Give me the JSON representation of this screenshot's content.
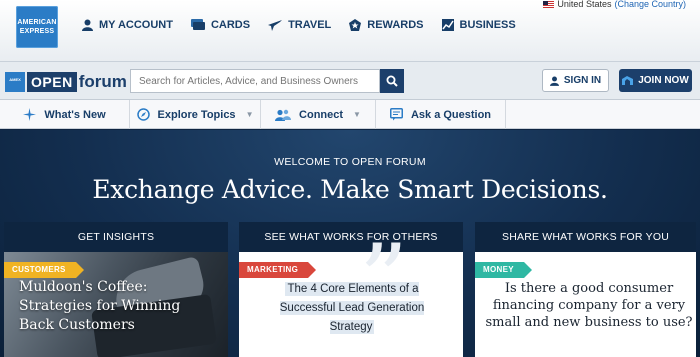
{
  "country": {
    "name": "United States",
    "change_link": "(Change Country)"
  },
  "brand": {
    "logo_top": "AMERICAN",
    "logo_bottom": "EXPRESS"
  },
  "topnav": [
    {
      "label": "MY ACCOUNT",
      "icon": "person-icon"
    },
    {
      "label": "CARDS",
      "icon": "cards-icon"
    },
    {
      "label": "TRAVEL",
      "icon": "airplane-icon"
    },
    {
      "label": "REWARDS",
      "icon": "rewards-icon"
    },
    {
      "label": "BUSINESS",
      "icon": "business-chart-icon"
    }
  ],
  "forum": {
    "logo_open": "OPEN",
    "logo_forum": "forum",
    "search_placeholder": "Search for Articles, Advice, and Business Owners",
    "signin_label": "SIGN IN",
    "join_label": "JOIN NOW"
  },
  "subnav": [
    {
      "label": "What's New",
      "icon": "sparkle-icon",
      "has_caret": false
    },
    {
      "label": "Explore Topics",
      "icon": "compass-icon",
      "has_caret": true
    },
    {
      "label": "Connect",
      "icon": "people-icon",
      "has_caret": true
    },
    {
      "label": "Ask a Question",
      "icon": "chat-icon",
      "has_caret": false
    }
  ],
  "hero": {
    "welcome": "WELCOME TO OPEN FORUM",
    "headline": "Exchange Advice. Make Smart Decisions."
  },
  "columns": [
    {
      "heading": "GET INSIGHTS",
      "tag": "CUSTOMERS",
      "tag_color": "#f0b323",
      "title": "Muldoon's Coffee: Strategies for Winning Back Customers"
    },
    {
      "heading": "SEE WHAT WORKS FOR OTHERS",
      "tag": "MARKETING",
      "tag_color": "#d9473c",
      "title": "The 4 Core Elements of a Successful Lead Generation Strategy"
    },
    {
      "heading": "SHARE WHAT WORKS FOR YOU",
      "tag": "MONEY",
      "tag_color": "#2fb8a3",
      "title": "Is there a good consumer financing company for a very small and new business to use?"
    }
  ],
  "colors": {
    "navy": "#1c3f6b",
    "amex_blue": "#2b7cc6",
    "hero_bg": "#132e4f"
  }
}
